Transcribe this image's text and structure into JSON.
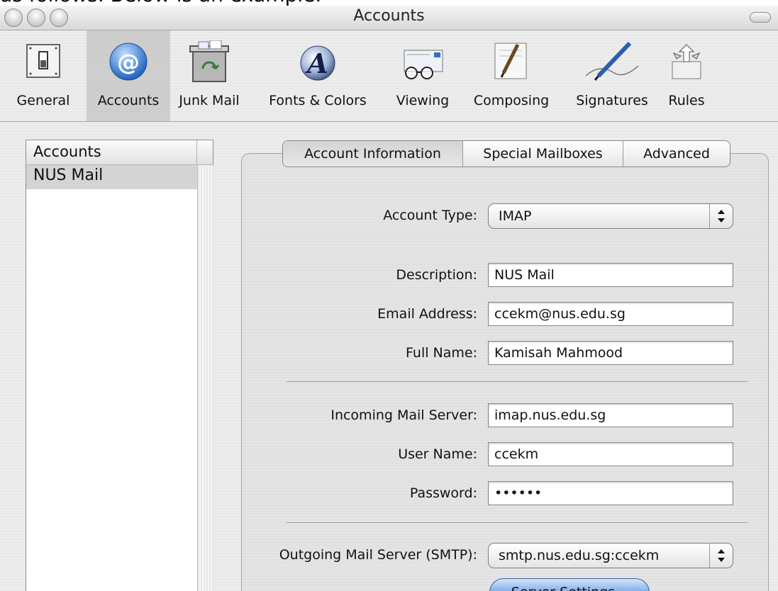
{
  "caption": "as follows. Below is an example.",
  "window": {
    "title": "Accounts"
  },
  "toolbar": {
    "items": [
      {
        "label": "General",
        "icon": "switch-icon"
      },
      {
        "label": "Accounts",
        "icon": "at-sign-icon",
        "selected": true
      },
      {
        "label": "Junk Mail",
        "icon": "recycle-bin-icon"
      },
      {
        "label": "Fonts & Colors",
        "icon": "font-icon"
      },
      {
        "label": "Viewing",
        "icon": "glasses-icon"
      },
      {
        "label": "Composing",
        "icon": "pencil-icon"
      },
      {
        "label": "Signatures",
        "icon": "pen-icon"
      },
      {
        "label": "Rules",
        "icon": "arrows-icon"
      }
    ]
  },
  "accounts_list": {
    "header": "Accounts",
    "items": [
      "NUS Mail"
    ]
  },
  "tabs": [
    "Account Information",
    "Special Mailboxes",
    "Advanced"
  ],
  "form": {
    "account_type_label": "Account Type:",
    "account_type_value": "IMAP",
    "description_label": "Description:",
    "description_value": "NUS Mail",
    "email_label": "Email Address:",
    "email_value": "ccekm@nus.edu.sg",
    "full_name_label": "Full Name:",
    "full_name_value": "Kamisah Mahmood",
    "incoming_label": "Incoming Mail Server:",
    "incoming_value": "imap.nus.edu.sg",
    "username_label": "User Name:",
    "username_value": "ccekm",
    "password_label": "Password:",
    "password_value": "••••••",
    "smtp_label": "Outgoing Mail Server (SMTP):",
    "smtp_value": "smtp.nus.edu.sg:ccekm",
    "server_settings_label": "Server Settings..."
  },
  "colors": {
    "selected_toolbar": "#c9c9c9",
    "aqua_button": "#5d8fdb",
    "list_selection": "#d4d4d4"
  }
}
